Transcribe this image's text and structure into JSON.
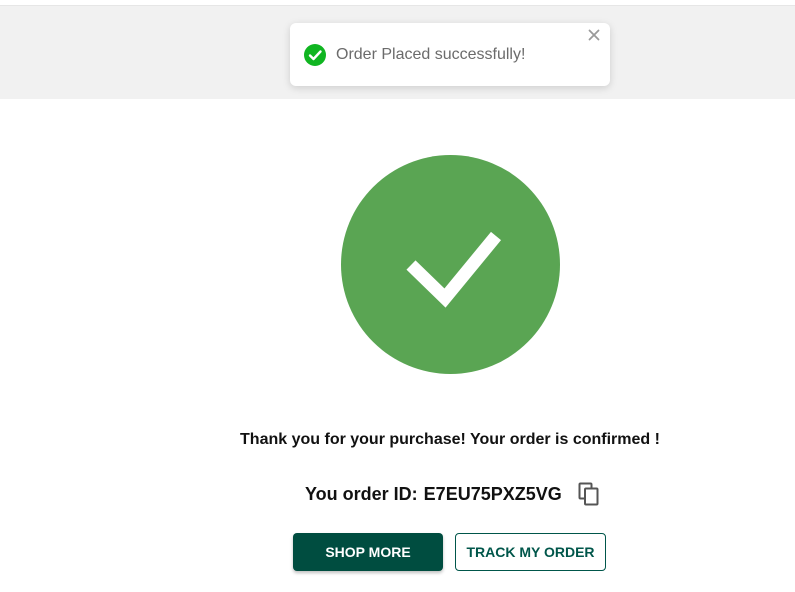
{
  "toast": {
    "message": "Order Placed successfully!",
    "status_icon": "check-circle-icon",
    "close_icon": "close-icon",
    "status_color": "#10b521"
  },
  "confirmation": {
    "icon": "checkmark-icon",
    "circle_color": "#5aa553",
    "thanks_text": "Thank you for your purchase! Your order is confirmed !",
    "order_label": "You order ID:",
    "order_id": "E7EU75PXZ5VG",
    "copy_icon": "copy-icon"
  },
  "actions": {
    "shop_more_label": "SHOP MORE",
    "track_order_label": "TRACK MY ORDER",
    "primary_color": "#004d40"
  }
}
